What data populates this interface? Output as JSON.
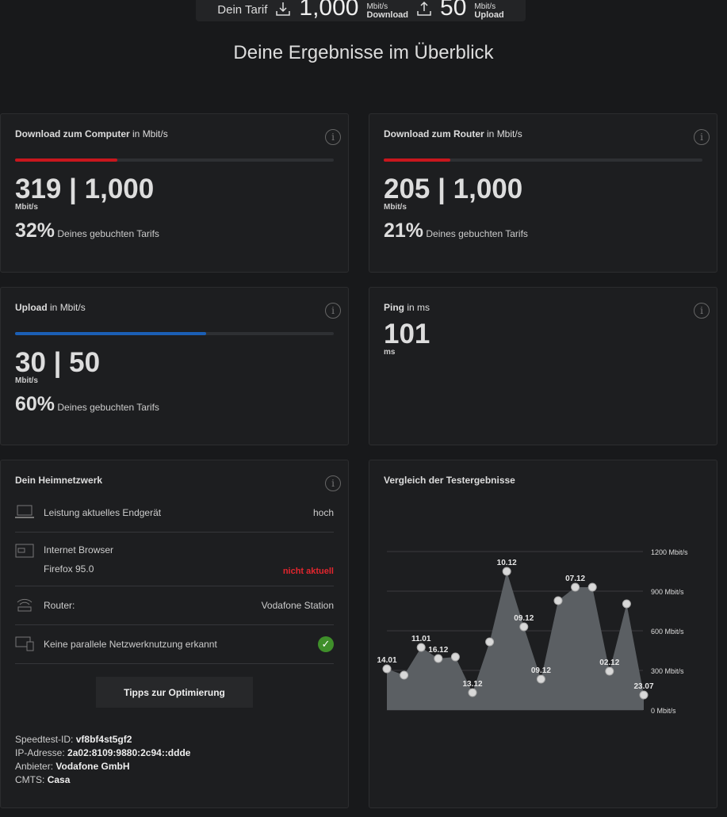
{
  "tarif": {
    "label": "Dein Tarif",
    "download_value": "1,000",
    "download_unit": "Mbit/s",
    "download_label": "Download",
    "upload_value": "50",
    "upload_unit": "Mbit/s",
    "upload_label": "Upload"
  },
  "heading": "Deine Ergebnisse im Überblick",
  "cards": {
    "download_computer": {
      "title": "Download zum Computer",
      "unit_suffix": "in Mbit/s",
      "value": "319 | 1,000",
      "unit": "Mbit/s",
      "percent": "32%",
      "percent_text": "Deines gebuchten Tarifs",
      "fill": 0.32,
      "color": "#c8161d"
    },
    "download_router": {
      "title": "Download zum Router",
      "unit_suffix": "in Mbit/s",
      "value": "205 | 1,000",
      "unit": "Mbit/s",
      "percent": "21%",
      "percent_text": "Deines gebuchten Tarifs",
      "fill": 0.21,
      "color": "#c8161d"
    },
    "upload": {
      "title": "Upload",
      "unit_suffix": "in Mbit/s",
      "value": "30 | 50",
      "unit": "Mbit/s",
      "percent": "60%",
      "percent_text": "Deines gebuchten Tarifs",
      "fill": 0.6,
      "color": "#1b5fb5"
    },
    "ping": {
      "title": "Ping",
      "unit_suffix": "in ms",
      "value": "101",
      "unit": "ms"
    }
  },
  "heimnetz": {
    "title": "Dein Heimnetzwerk",
    "device_label": "Leistung aktuelles Endgerät",
    "device_value": "hoch",
    "browser_label": "Internet Browser",
    "browser_name": "Firefox 95.0",
    "browser_status": "nicht aktuell",
    "browser_status_color": "#e3262e",
    "router_label": "Router:",
    "router_value": "Vodafone Station",
    "parallel_label": "Keine parallele Netzwerknutzung erkannt",
    "button": "Tipps zur Optimierung",
    "speedtest_id_label": "Speedtest-ID:",
    "speedtest_id": "vf8bf4st5gf2",
    "ip_label": "IP-Adresse:",
    "ip": "2a02:8109:9880:2c94::ddde",
    "provider_label": "Anbieter:",
    "provider": "Vodafone GmbH",
    "cmts_label": "CMTS:",
    "cmts": "Casa"
  },
  "chart_data": {
    "type": "area",
    "title": "Vergleich der Testergebnisse",
    "ylim": [
      0,
      1200
    ],
    "yticks": [
      "0 Mbit/s",
      "300 Mbit/s",
      "600 Mbit/s",
      "900 Mbit/s",
      "1200 Mbit/s"
    ],
    "grid": true,
    "labels": [
      "14.01",
      "",
      "11.01",
      "16.12",
      "",
      "13.12",
      "",
      "10.12",
      "09.12",
      "09.12",
      "",
      "07.12",
      "",
      "02.12",
      "",
      "23.07"
    ],
    "values": [
      312,
      264,
      474,
      390,
      402,
      132,
      516,
      1050,
      630,
      234,
      828,
      930,
      930,
      294,
      804,
      114
    ]
  }
}
